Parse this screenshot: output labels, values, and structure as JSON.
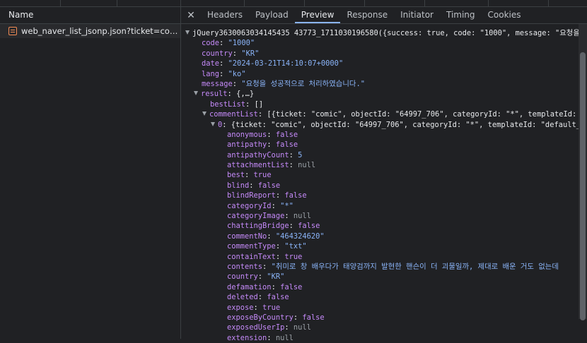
{
  "network": {
    "name_header": "Name",
    "request": "web_naver_list_jsonp.json?ticket=comic&te..."
  },
  "tabs": [
    "Headers",
    "Payload",
    "Preview",
    "Response",
    "Initiator",
    "Timing",
    "Cookies"
  ],
  "active_tab": "Preview",
  "colors": {
    "accent": "#8ab4f8",
    "key": "#c58af9",
    "string": "#8ab4f8",
    "null": "#9aa0a6"
  },
  "preview": {
    "root": "jQuery36300630341454377 3_1711030196580({success: true, code: \"1000\", message: \"요청을 성공",
    "lines": [
      {
        "indent": 0,
        "tri": true,
        "key": "",
        "raw": "jQuery3630063034145435 43773_1711030196580({success: true, code: \"1000\", message: \"요청을 성공"
      },
      {
        "indent": 1,
        "key": "code",
        "type": "string",
        "value": "\"1000\""
      },
      {
        "indent": 1,
        "key": "country",
        "type": "string",
        "value": "\"KR\""
      },
      {
        "indent": 1,
        "key": "date",
        "type": "string",
        "value": "\"2024-03-21T14:10:07+0000\""
      },
      {
        "indent": 1,
        "key": "lang",
        "type": "string",
        "value": "\"ko\""
      },
      {
        "indent": 1,
        "key": "message",
        "type": "string",
        "value": "\"요청을 성공적으로 처리하였습니다.\""
      },
      {
        "indent": 1,
        "tri": true,
        "key": "result",
        "type": "plain",
        "value": "{,…}"
      },
      {
        "indent": 2,
        "key": "bestList",
        "type": "plain",
        "value": "[]"
      },
      {
        "indent": 2,
        "tri": true,
        "key": "commentList",
        "type": "plain",
        "value": "[{ticket: \"comic\", objectId: \"64997_706\", categoryId: \"*\", templateId: \"def"
      },
      {
        "indent": 3,
        "tri": true,
        "key": "0",
        "type": "plain",
        "value": "{ticket: \"comic\", objectId: \"64997_706\", categoryId: \"*\", templateId: \"default_v2\","
      },
      {
        "indent": 4,
        "key": "anonymous",
        "type": "bool",
        "value": "false"
      },
      {
        "indent": 4,
        "key": "antipathy",
        "type": "bool",
        "value": "false"
      },
      {
        "indent": 4,
        "key": "antipathyCount",
        "type": "number",
        "value": "5"
      },
      {
        "indent": 4,
        "key": "attachmentList",
        "type": "null",
        "value": "null"
      },
      {
        "indent": 4,
        "key": "best",
        "type": "bool",
        "value": "true"
      },
      {
        "indent": 4,
        "key": "blind",
        "type": "bool",
        "value": "false"
      },
      {
        "indent": 4,
        "key": "blindReport",
        "type": "bool",
        "value": "false"
      },
      {
        "indent": 4,
        "key": "categoryId",
        "type": "string",
        "value": "\"*\""
      },
      {
        "indent": 4,
        "key": "categoryImage",
        "type": "null",
        "value": "null"
      },
      {
        "indent": 4,
        "key": "chattingBridge",
        "type": "bool",
        "value": "false"
      },
      {
        "indent": 4,
        "key": "commentNo",
        "type": "string",
        "value": "\"464324620\""
      },
      {
        "indent": 4,
        "key": "commentType",
        "type": "string",
        "value": "\"txt\""
      },
      {
        "indent": 4,
        "key": "containText",
        "type": "bool",
        "value": "true"
      },
      {
        "indent": 4,
        "key": "contents",
        "type": "string",
        "value": "\"취미로 창 배우다가 태양검까지 발현한 핸슨이 더 괴물일까, 제대로 배운 거도 없는데"
      },
      {
        "indent": 4,
        "key": "country",
        "type": "string",
        "value": "\"KR\""
      },
      {
        "indent": 4,
        "key": "defamation",
        "type": "bool",
        "value": "false"
      },
      {
        "indent": 4,
        "key": "deleted",
        "type": "bool",
        "value": "false"
      },
      {
        "indent": 4,
        "key": "expose",
        "type": "bool",
        "value": "true"
      },
      {
        "indent": 4,
        "key": "exposeByCountry",
        "type": "bool",
        "value": "false"
      },
      {
        "indent": 4,
        "key": "exposedUserIp",
        "type": "null",
        "value": "null"
      },
      {
        "indent": 4,
        "key": "extension",
        "type": "null",
        "value": "null"
      }
    ]
  }
}
